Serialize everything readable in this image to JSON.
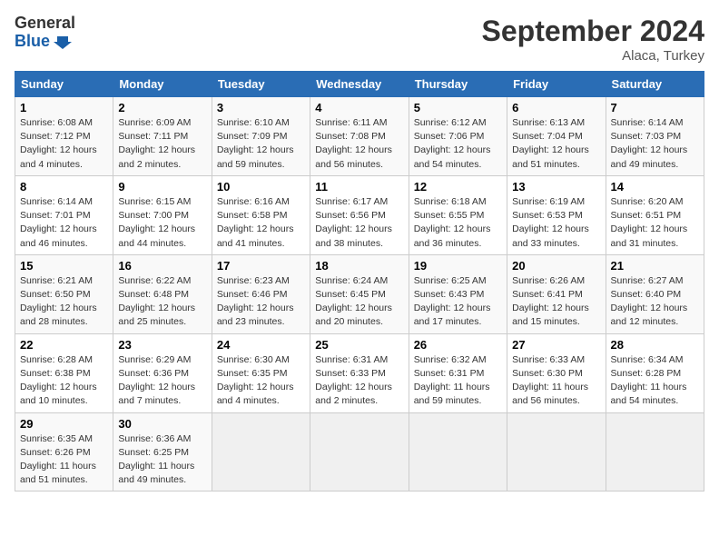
{
  "header": {
    "logo_line1": "General",
    "logo_line2": "Blue",
    "month": "September 2024",
    "location": "Alaca, Turkey"
  },
  "weekdays": [
    "Sunday",
    "Monday",
    "Tuesday",
    "Wednesday",
    "Thursday",
    "Friday",
    "Saturday"
  ],
  "weeks": [
    [
      {
        "day": "1",
        "sunrise": "Sunrise: 6:08 AM",
        "sunset": "Sunset: 7:12 PM",
        "daylight": "Daylight: 12 hours and 4 minutes."
      },
      {
        "day": "2",
        "sunrise": "Sunrise: 6:09 AM",
        "sunset": "Sunset: 7:11 PM",
        "daylight": "Daylight: 12 hours and 2 minutes."
      },
      {
        "day": "3",
        "sunrise": "Sunrise: 6:10 AM",
        "sunset": "Sunset: 7:09 PM",
        "daylight": "Daylight: 12 hours and 59 minutes."
      },
      {
        "day": "4",
        "sunrise": "Sunrise: 6:11 AM",
        "sunset": "Sunset: 7:08 PM",
        "daylight": "Daylight: 12 hours and 56 minutes."
      },
      {
        "day": "5",
        "sunrise": "Sunrise: 6:12 AM",
        "sunset": "Sunset: 7:06 PM",
        "daylight": "Daylight: 12 hours and 54 minutes."
      },
      {
        "day": "6",
        "sunrise": "Sunrise: 6:13 AM",
        "sunset": "Sunset: 7:04 PM",
        "daylight": "Daylight: 12 hours and 51 minutes."
      },
      {
        "day": "7",
        "sunrise": "Sunrise: 6:14 AM",
        "sunset": "Sunset: 7:03 PM",
        "daylight": "Daylight: 12 hours and 49 minutes."
      }
    ],
    [
      {
        "day": "8",
        "sunrise": "Sunrise: 6:14 AM",
        "sunset": "Sunset: 7:01 PM",
        "daylight": "Daylight: 12 hours and 46 minutes."
      },
      {
        "day": "9",
        "sunrise": "Sunrise: 6:15 AM",
        "sunset": "Sunset: 7:00 PM",
        "daylight": "Daylight: 12 hours and 44 minutes."
      },
      {
        "day": "10",
        "sunrise": "Sunrise: 6:16 AM",
        "sunset": "Sunset: 6:58 PM",
        "daylight": "Daylight: 12 hours and 41 minutes."
      },
      {
        "day": "11",
        "sunrise": "Sunrise: 6:17 AM",
        "sunset": "Sunset: 6:56 PM",
        "daylight": "Daylight: 12 hours and 38 minutes."
      },
      {
        "day": "12",
        "sunrise": "Sunrise: 6:18 AM",
        "sunset": "Sunset: 6:55 PM",
        "daylight": "Daylight: 12 hours and 36 minutes."
      },
      {
        "day": "13",
        "sunrise": "Sunrise: 6:19 AM",
        "sunset": "Sunset: 6:53 PM",
        "daylight": "Daylight: 12 hours and 33 minutes."
      },
      {
        "day": "14",
        "sunrise": "Sunrise: 6:20 AM",
        "sunset": "Sunset: 6:51 PM",
        "daylight": "Daylight: 12 hours and 31 minutes."
      }
    ],
    [
      {
        "day": "15",
        "sunrise": "Sunrise: 6:21 AM",
        "sunset": "Sunset: 6:50 PM",
        "daylight": "Daylight: 12 hours and 28 minutes."
      },
      {
        "day": "16",
        "sunrise": "Sunrise: 6:22 AM",
        "sunset": "Sunset: 6:48 PM",
        "daylight": "Daylight: 12 hours and 25 minutes."
      },
      {
        "day": "17",
        "sunrise": "Sunrise: 6:23 AM",
        "sunset": "Sunset: 6:46 PM",
        "daylight": "Daylight: 12 hours and 23 minutes."
      },
      {
        "day": "18",
        "sunrise": "Sunrise: 6:24 AM",
        "sunset": "Sunset: 6:45 PM",
        "daylight": "Daylight: 12 hours and 20 minutes."
      },
      {
        "day": "19",
        "sunrise": "Sunrise: 6:25 AM",
        "sunset": "Sunset: 6:43 PM",
        "daylight": "Daylight: 12 hours and 17 minutes."
      },
      {
        "day": "20",
        "sunrise": "Sunrise: 6:26 AM",
        "sunset": "Sunset: 6:41 PM",
        "daylight": "Daylight: 12 hours and 15 minutes."
      },
      {
        "day": "21",
        "sunrise": "Sunrise: 6:27 AM",
        "sunset": "Sunset: 6:40 PM",
        "daylight": "Daylight: 12 hours and 12 minutes."
      }
    ],
    [
      {
        "day": "22",
        "sunrise": "Sunrise: 6:28 AM",
        "sunset": "Sunset: 6:38 PM",
        "daylight": "Daylight: 12 hours and 10 minutes."
      },
      {
        "day": "23",
        "sunrise": "Sunrise: 6:29 AM",
        "sunset": "Sunset: 6:36 PM",
        "daylight": "Daylight: 12 hours and 7 minutes."
      },
      {
        "day": "24",
        "sunrise": "Sunrise: 6:30 AM",
        "sunset": "Sunset: 6:35 PM",
        "daylight": "Daylight: 12 hours and 4 minutes."
      },
      {
        "day": "25",
        "sunrise": "Sunrise: 6:31 AM",
        "sunset": "Sunset: 6:33 PM",
        "daylight": "Daylight: 12 hours and 2 minutes."
      },
      {
        "day": "26",
        "sunrise": "Sunrise: 6:32 AM",
        "sunset": "Sunset: 6:31 PM",
        "daylight": "Daylight: 11 hours and 59 minutes."
      },
      {
        "day": "27",
        "sunrise": "Sunrise: 6:33 AM",
        "sunset": "Sunset: 6:30 PM",
        "daylight": "Daylight: 11 hours and 56 minutes."
      },
      {
        "day": "28",
        "sunrise": "Sunrise: 6:34 AM",
        "sunset": "Sunset: 6:28 PM",
        "daylight": "Daylight: 11 hours and 54 minutes."
      }
    ],
    [
      {
        "day": "29",
        "sunrise": "Sunrise: 6:35 AM",
        "sunset": "Sunset: 6:26 PM",
        "daylight": "Daylight: 11 hours and 51 minutes."
      },
      {
        "day": "30",
        "sunrise": "Sunrise: 6:36 AM",
        "sunset": "Sunset: 6:25 PM",
        "daylight": "Daylight: 11 hours and 49 minutes."
      },
      null,
      null,
      null,
      null,
      null
    ]
  ]
}
